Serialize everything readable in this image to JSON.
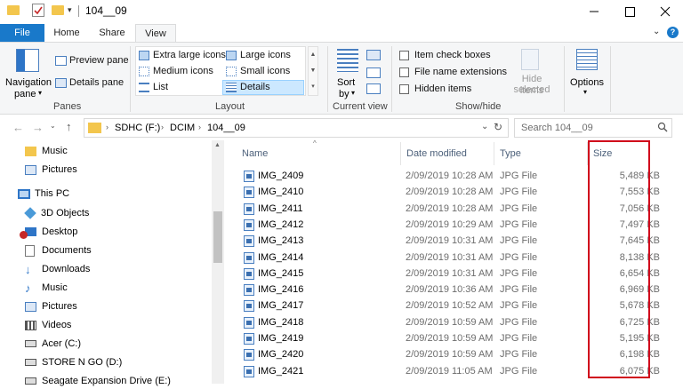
{
  "window": {
    "title": "104__09",
    "controls": [
      "minimize-icon",
      "maximize-icon",
      "close-icon"
    ]
  },
  "tabs": {
    "file": "File",
    "home": "Home",
    "share": "Share",
    "view": "View"
  },
  "ribbon": {
    "panes": {
      "navigation_pane_line1": "Navigation",
      "navigation_pane_line2": "pane",
      "preview_pane": "Preview pane",
      "details_pane": "Details pane",
      "group_label": "Panes"
    },
    "layout": {
      "extra_large_icons": "Extra large icons",
      "large_icons": "Large icons",
      "medium_icons": "Medium icons",
      "small_icons": "Small icons",
      "list": "List",
      "details": "Details",
      "group_label": "Layout"
    },
    "current_view": {
      "sort_line1": "Sort",
      "sort_line2": "by",
      "group_label": "Current view"
    },
    "show_hide": {
      "item_check_boxes": "Item check boxes",
      "file_name_extensions": "File name extensions",
      "hidden_items": "Hidden items",
      "hide_selected_line1": "Hide selected",
      "hide_selected_line2": "items",
      "group_label": "Show/hide"
    },
    "options": "Options"
  },
  "address": {
    "crumbs": [
      "SDHC (F:)",
      "DCIM",
      "104__09"
    ],
    "search_placeholder": "Search 104__09"
  },
  "nav": {
    "items": [
      {
        "label": "Music",
        "icon": "folder-icon"
      },
      {
        "label": "Pictures",
        "icon": "pictures-icon"
      },
      {
        "label": "This PC",
        "icon": "computer-icon"
      },
      {
        "label": "3D Objects",
        "icon": "3d-objects-icon"
      },
      {
        "label": "Desktop",
        "icon": "desktop-icon"
      },
      {
        "label": "Documents",
        "icon": "documents-icon"
      },
      {
        "label": "Downloads",
        "icon": "downloads-icon"
      },
      {
        "label": "Music",
        "icon": "music-icon"
      },
      {
        "label": "Pictures",
        "icon": "pictures-icon"
      },
      {
        "label": "Videos",
        "icon": "videos-icon"
      },
      {
        "label": "Acer (C:)",
        "icon": "drive-icon"
      },
      {
        "label": "STORE N GO (D:)",
        "icon": "drive-icon"
      },
      {
        "label": "Seagate Expansion Drive (E:)",
        "icon": "drive-icon"
      }
    ]
  },
  "columns": {
    "name": "Name",
    "date": "Date modified",
    "type": "Type",
    "size": "Size"
  },
  "files": [
    {
      "name": "IMG_2409",
      "date": "2/09/2019 10:28 AM",
      "type": "JPG File",
      "size": "5,489 KB"
    },
    {
      "name": "IMG_2410",
      "date": "2/09/2019 10:28 AM",
      "type": "JPG File",
      "size": "7,553 KB"
    },
    {
      "name": "IMG_2411",
      "date": "2/09/2019 10:28 AM",
      "type": "JPG File",
      "size": "7,056 KB"
    },
    {
      "name": "IMG_2412",
      "date": "2/09/2019 10:29 AM",
      "type": "JPG File",
      "size": "7,497 KB"
    },
    {
      "name": "IMG_2413",
      "date": "2/09/2019 10:31 AM",
      "type": "JPG File",
      "size": "7,645 KB"
    },
    {
      "name": "IMG_2414",
      "date": "2/09/2019 10:31 AM",
      "type": "JPG File",
      "size": "8,138 KB"
    },
    {
      "name": "IMG_2415",
      "date": "2/09/2019 10:31 AM",
      "type": "JPG File",
      "size": "6,654 KB"
    },
    {
      "name": "IMG_2416",
      "date": "2/09/2019 10:36 AM",
      "type": "JPG File",
      "size": "6,969 KB"
    },
    {
      "name": "IMG_2417",
      "date": "2/09/2019 10:52 AM",
      "type": "JPG File",
      "size": "5,678 KB"
    },
    {
      "name": "IMG_2418",
      "date": "2/09/2019 10:59 AM",
      "type": "JPG File",
      "size": "6,725 KB"
    },
    {
      "name": "IMG_2419",
      "date": "2/09/2019 10:59 AM",
      "type": "JPG File",
      "size": "5,195 KB"
    },
    {
      "name": "IMG_2420",
      "date": "2/09/2019 10:59 AM",
      "type": "JPG File",
      "size": "6,198 KB"
    },
    {
      "name": "IMG_2421",
      "date": "2/09/2019 11:05 AM",
      "type": "JPG File",
      "size": "6,075 KB"
    }
  ],
  "colors": {
    "file_tab": "#1979ca",
    "highlight_box": "#d0021b",
    "selection": "#cce8ff"
  }
}
